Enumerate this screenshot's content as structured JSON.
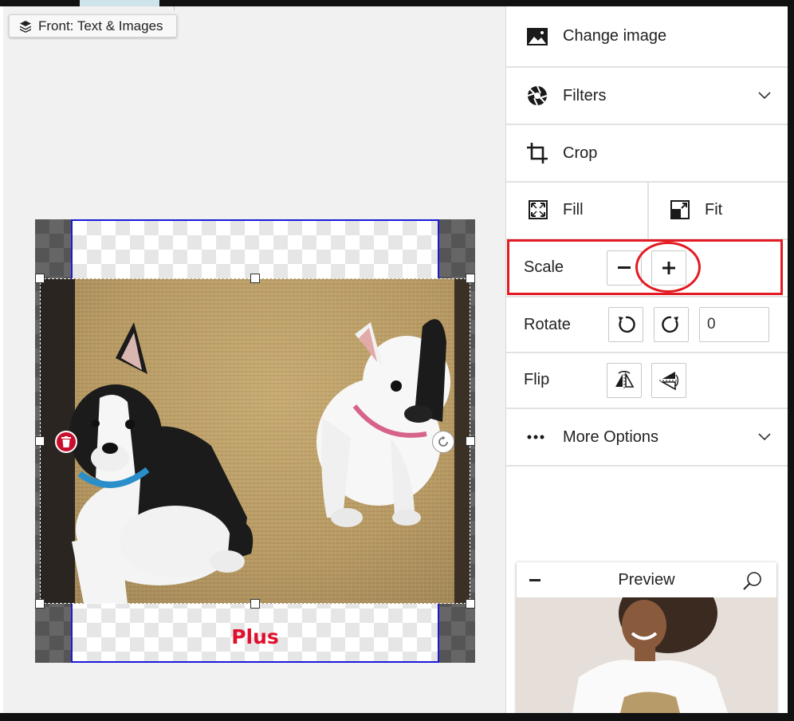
{
  "canvas": {
    "layer_chip_label": "Front: Text & Images",
    "overlay_label": "Plus"
  },
  "panel": {
    "change_image_label": "Change image",
    "filters_label": "Filters",
    "crop_label": "Crop",
    "fill_label": "Fill",
    "fit_label": "Fit",
    "scale_label": "Scale",
    "rotate_label": "Rotate",
    "rotate_value": "0",
    "flip_label": "Flip",
    "more_options_label": "More Options"
  },
  "preview": {
    "title": "Preview"
  },
  "colors": {
    "highlight": "#e31b23",
    "safe_area_border": "#1a1ad6",
    "delete_button": "#c8102e"
  }
}
